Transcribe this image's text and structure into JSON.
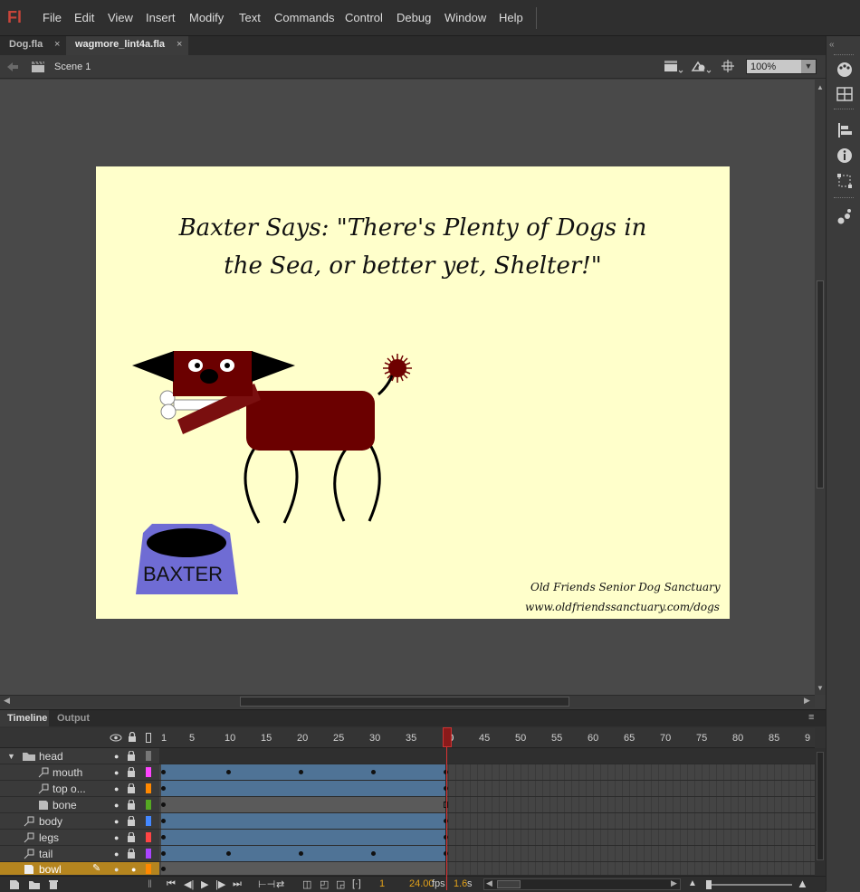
{
  "app": {
    "logo": "Fl"
  },
  "menu": [
    "File",
    "Edit",
    "View",
    "Insert",
    "Modify",
    "Text",
    "Commands",
    "Control",
    "Debug",
    "Window",
    "Help"
  ],
  "doc_tabs": [
    {
      "label": "Dog.fla",
      "close": "×"
    },
    {
      "label": "wagmore_lint4a.fla",
      "close": "×"
    }
  ],
  "editbar": {
    "scene": "Scene 1",
    "zoom": "100%"
  },
  "stage": {
    "bg_color": "#ffffcb",
    "quote_line1": "Baxter Says: \"There's Plenty of Dogs in",
    "quote_line2": "the Sea, or better yet, Shelter!\"",
    "bowl_label": "BAXTER",
    "credit_line1": "Old Friends Senior Dog Sanctuary",
    "credit_line2": "www.oldfriendssanctuary.com/dogs"
  },
  "timeline": {
    "tabs": [
      "Timeline",
      "Output"
    ],
    "ruler": [
      "1",
      "5",
      "10",
      "15",
      "20",
      "25",
      "30",
      "35",
      "40",
      "45",
      "50",
      "55",
      "60",
      "65",
      "70",
      "75",
      "80",
      "85",
      "9"
    ],
    "layers": [
      {
        "name": "head",
        "color": "#777777",
        "kind": "folder"
      },
      {
        "name": "mouth",
        "color": "#ff44ff",
        "kind": "layer"
      },
      {
        "name": "top o...",
        "color": "#ff8800",
        "kind": "layer"
      },
      {
        "name": "bone",
        "color": "#55aa22",
        "kind": "layer"
      },
      {
        "name": "body",
        "color": "#4488ff",
        "kind": "layer"
      },
      {
        "name": "legs",
        "color": "#ff4444",
        "kind": "layer"
      },
      {
        "name": "tail",
        "color": "#aa44ff",
        "kind": "layer"
      },
      {
        "name": "bowl",
        "color": "#ff8800",
        "kind": "layer"
      }
    ],
    "current_frame": "1",
    "fps": "24.00",
    "fps_unit": "fps",
    "elapsed": "1.6",
    "elapsed_unit": "s",
    "playhead_frame": "40"
  }
}
